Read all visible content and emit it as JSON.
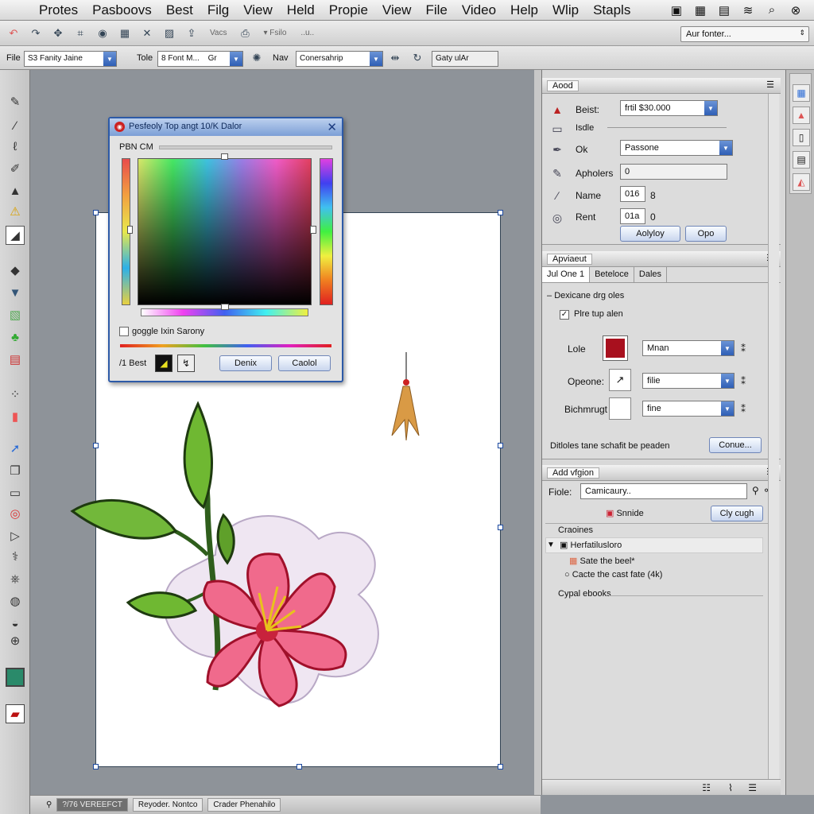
{
  "menubar": {
    "items": [
      "Protes",
      "Pasboovs",
      "Best",
      "Filg",
      "View",
      "Held",
      "Propie",
      "View",
      "File",
      "Video",
      "Help",
      "Wlip",
      "Stapls"
    ]
  },
  "toolbar1": {
    "text_a": "Vacs",
    "text_b": "▾ Fsilo",
    "text_c": "..u..",
    "workspace": "Aur fonter..."
  },
  "toolbar2": {
    "file_label": "File",
    "file_value": "S3 Fanity Jaine",
    "tole_label": "Tole",
    "tole_value": "8 Font M...",
    "tole_extra": "Gr",
    "nav_label": "Nav",
    "nav_value": "Conersahrip",
    "path_value": "Gaty ulAr"
  },
  "dialog": {
    "title": "Pesfeoly Top angt 10/K Dalor",
    "subtitle": "PBN CM",
    "checkbox_label": "goggle Ixin Sarony",
    "best_label": "/1 Best",
    "ok_label": "Denix",
    "cancel_label": "Caolol"
  },
  "panel1": {
    "tab": "Aood",
    "rows": [
      {
        "label": "Beist:",
        "value": "frtil $30.000"
      },
      {
        "label": "Isdle",
        "value": ""
      },
      {
        "label": "Ok",
        "value": "Passone"
      },
      {
        "label": "Apholers",
        "value": "0"
      },
      {
        "label": "Name",
        "value": "016",
        "extra": "8"
      },
      {
        "label": "Rent",
        "value": "01a",
        "extra": "0"
      }
    ],
    "btn1": "Aolyloy",
    "btn2": "Opo"
  },
  "panel2": {
    "title": "Apviaeut",
    "tabs": [
      "Jul One 1",
      "Beteloce",
      "Dales"
    ],
    "section": "Dexicane drg oles",
    "checkbox": "Plre tup alen",
    "rows": [
      {
        "label": "Lole",
        "value": "Mnan"
      },
      {
        "label": "Opeone:",
        "value": "filie"
      },
      {
        "label": "Bichmrugt",
        "value": "fine"
      }
    ],
    "note": "Ditloles tane schafit be peaden",
    "confirm": "Conue..."
  },
  "panel3": {
    "tab": "Add vfgion",
    "fiole_label": "Fiole:",
    "fiole_value": "Camicaury..",
    "smile": "Snnide",
    "button": "Cly cugh",
    "section1": "Craoines",
    "tree_item": "Herfatilusloro",
    "sub1": "Sate the beel*",
    "sub2": "Cacte the cast fate (4k)",
    "section2": "Cypal ebooks"
  },
  "statusbar": {
    "item1": "?/76 VEREEFCT",
    "item2": "Reyoder. Nontco",
    "item3": "Crader Phenahilo"
  },
  "colors": {
    "selection_blue": "#2d5aa7",
    "swatch_red": "#a8101e"
  }
}
